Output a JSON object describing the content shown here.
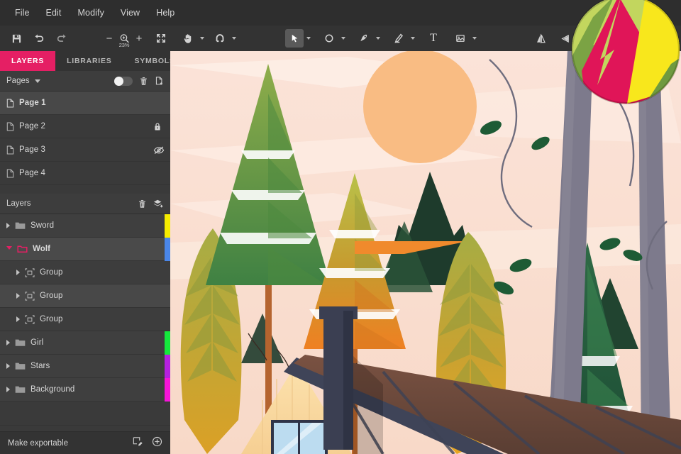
{
  "app": {
    "zoom_level": "23%",
    "accent_color": "#e51f64",
    "panel_bg": "#3a3a3a",
    "toolbar_bg": "#333333"
  },
  "menu": {
    "items": [
      {
        "label": "File"
      },
      {
        "label": "Edit"
      },
      {
        "label": "Modify"
      },
      {
        "label": "View"
      },
      {
        "label": "Help"
      }
    ]
  },
  "toolbar": {
    "save": "save-icon",
    "undo": "undo-icon",
    "redo": "redo-icon",
    "zoom_out": "−",
    "zoom_in": "+",
    "zoom_icon": "zoom-in-icon",
    "zoom_value": "23%",
    "fit_to_screen": "fit-screen-icon",
    "hand_tool": "hand-icon",
    "snap_tool": "magnet-icon",
    "pointer_tool": "pointer-icon",
    "ellipse_tool": "ellipse-icon",
    "pen_tool": "pen-icon",
    "pencil_tool": "pencil-icon",
    "text_tool": "T",
    "image_tool": "image-icon",
    "flip_horizontal": "flip-horizontal-icon",
    "flip_vertical": "flip-vertical-icon",
    "rotate_ccw": "rotate-ccw-icon",
    "rotate_cw": "rotate-cw-icon"
  },
  "panel": {
    "tabs": [
      {
        "label": "LAYERS",
        "active": true
      },
      {
        "label": "LIBRARIES",
        "active": false
      },
      {
        "label": "SYMBOLS",
        "active": false
      }
    ],
    "pages_section": {
      "title": "Pages",
      "toggle_state": "off",
      "delete_icon": "trash-icon",
      "add_icon": "add-page-icon",
      "items": [
        {
          "label": "Page 1",
          "selected": true,
          "status": ""
        },
        {
          "label": "Page 2",
          "selected": false,
          "status": "locked"
        },
        {
          "label": "Page 3",
          "selected": false,
          "status": "hidden"
        },
        {
          "label": "Page 4",
          "selected": false,
          "status": ""
        }
      ]
    },
    "layers_section": {
      "title": "Layers",
      "delete_icon": "trash-icon",
      "add_icon": "add-layer-icon",
      "items": [
        {
          "label": "Sword",
          "type": "folder",
          "expanded": false,
          "selected": false,
          "indent": 0,
          "swatch": "#f5ec00"
        },
        {
          "label": "Wolf",
          "type": "folder",
          "expanded": true,
          "selected": true,
          "indent": 0,
          "swatch": "#4a86e8"
        },
        {
          "label": "Group",
          "type": "group",
          "expanded": false,
          "selected": false,
          "indent": 1,
          "swatch": ""
        },
        {
          "label": "Group",
          "type": "group",
          "expanded": false,
          "selected": true,
          "indent": 1,
          "swatch": ""
        },
        {
          "label": "Group",
          "type": "group",
          "expanded": false,
          "selected": false,
          "indent": 1,
          "swatch": ""
        },
        {
          "label": "Girl",
          "type": "folder",
          "expanded": false,
          "selected": false,
          "indent": 0,
          "swatch": "#14e83c"
        },
        {
          "label": "Stars",
          "type": "folder",
          "expanded": false,
          "selected": false,
          "indent": 0,
          "swatch": "#b520e0"
        },
        {
          "label": "Background",
          "type": "folder",
          "expanded": false,
          "selected": false,
          "indent": 0,
          "swatch": "#f614d8"
        }
      ]
    },
    "footer": {
      "label": "Make exportable",
      "export_icon": "export-artboard-icon",
      "add_icon": "plus-circle-icon"
    }
  },
  "canvas": {
    "artwork_name": "forest-cabin-illustration",
    "colors": {
      "sky": "#fadfd2",
      "sky_light": "#fdeee6",
      "sun": "#f9bc83",
      "pine_green": "#6d9b3f",
      "pine_green_dark": "#3f8143",
      "pine_dark": "#1e3b2c",
      "pine_olive": "#a8a832",
      "pine_orange": "#ef8022",
      "leaf_olive": "#a5ad44",
      "leaf_gold": "#e3a321",
      "trunk_gray": "#7d7a8c",
      "roof_brown": "#6b4a3c",
      "cabin_cream": "#fadfa8",
      "window_blue": "#bcdcf0",
      "chimney": "#3b3f52"
    }
  },
  "loupe": {
    "name": "zoom-loupe-overlay",
    "colors": {
      "green": "#c2d65e",
      "crimson": "#e01558",
      "yellow": "#f8e71c",
      "green_dark": "#6f9a3f"
    }
  }
}
